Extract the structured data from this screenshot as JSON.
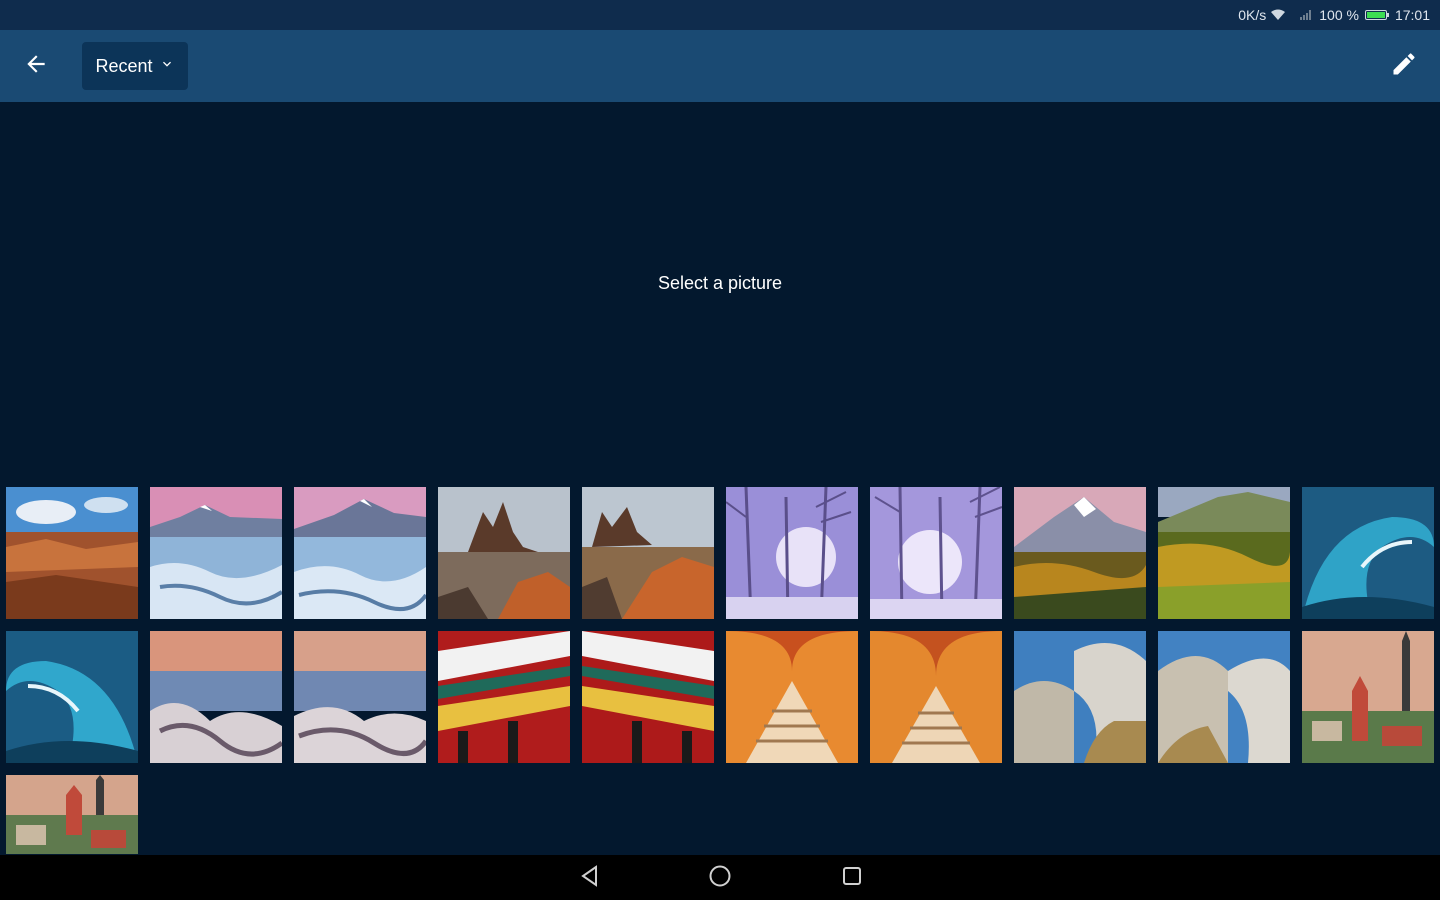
{
  "status_bar": {
    "network_speed": "0K/s",
    "battery_percent": "100 %",
    "time": "17:01",
    "icons": [
      "wifi-icon",
      "signal-icon",
      "battery-icon"
    ],
    "battery_color": "#3ddc53"
  },
  "toolbar": {
    "back_icon": "arrow-left-icon",
    "dropdown_label": "Recent",
    "dropdown_icon": "chevron-down-icon",
    "edit_icon": "pencil-icon",
    "background": "#1a4a73"
  },
  "preview": {
    "message": "Select a picture"
  },
  "gallery": {
    "thumbnails": [
      {
        "subject": "canyon-desert"
      },
      {
        "subject": "frozen-lake-mountain"
      },
      {
        "subject": "frozen-lake-mountain"
      },
      {
        "subject": "desert-rock-spire"
      },
      {
        "subject": "desert-rock-spire"
      },
      {
        "subject": "snowy-forest"
      },
      {
        "subject": "snowy-forest"
      },
      {
        "subject": "autumn-mountain"
      },
      {
        "subject": "autumn-mountain"
      },
      {
        "subject": "ocean-wave"
      },
      {
        "subject": "ocean-wave"
      },
      {
        "subject": "icy-coast-sunset"
      },
      {
        "subject": "icy-coast-sunset"
      },
      {
        "subject": "asian-temple-roof"
      },
      {
        "subject": "asian-temple-roof"
      },
      {
        "subject": "arched-architecture"
      },
      {
        "subject": "arched-architecture"
      },
      {
        "subject": "metallic-building"
      },
      {
        "subject": "metallic-building"
      },
      {
        "subject": "old-town-towers"
      },
      {
        "subject": "old-town-towers"
      }
    ]
  },
  "nav_bar": {
    "buttons": [
      "back-triangle-icon",
      "home-circle-icon",
      "recents-square-icon"
    ]
  }
}
